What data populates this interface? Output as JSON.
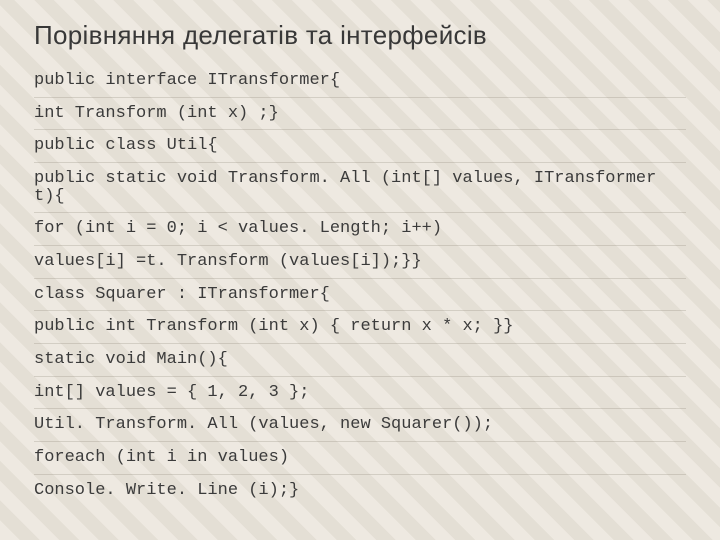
{
  "title": "Порівняння делегатів та інтерфейсів",
  "code_lines": [
    "public interface ITransformer{",
    "int Transform (int x) ;}",
    "public class Util{",
    "public static void Transform. All (int[] values, ITransformer t){",
    "for (int i = 0; i < values. Length; i++)",
    "values[i] =t. Transform (values[i]);}}",
    "class Squarer : ITransformer{",
    "public int Transform (int x) { return x * x; }}",
    "static void Main(){",
    "int[] values = { 1, 2, 3 };",
    "Util. Transform. All (values, new Squarer());",
    "foreach (int i in values)",
    "Console. Write. Line (i);}"
  ]
}
